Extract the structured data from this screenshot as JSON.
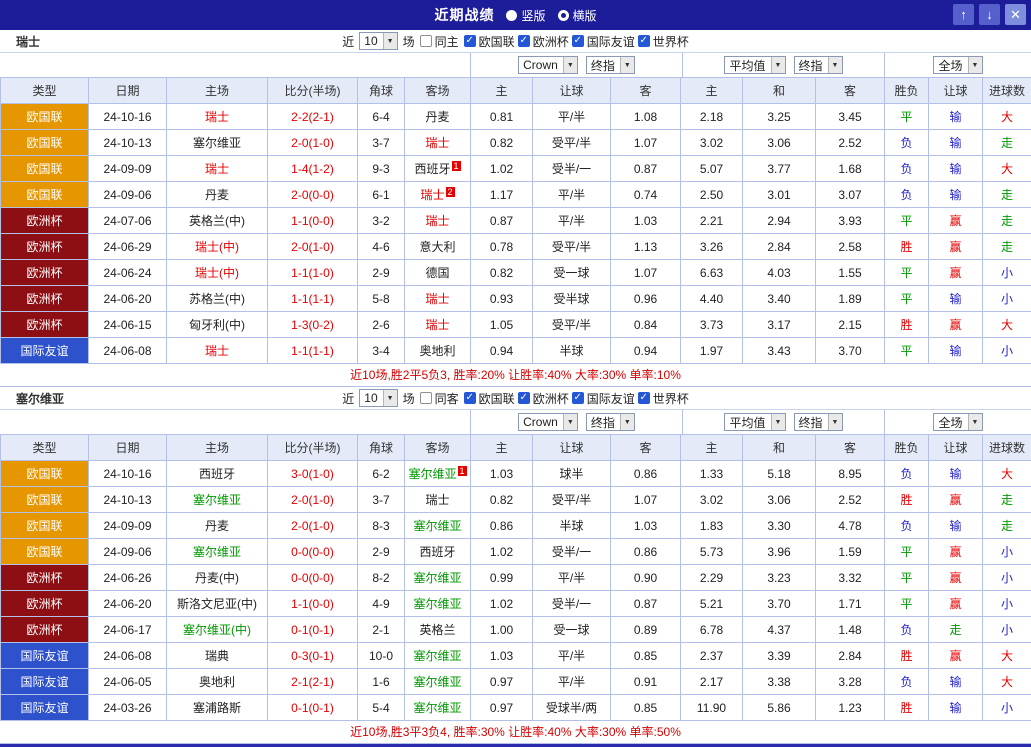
{
  "titlebar": {
    "title": "近期战绩",
    "vertical_label": "竖版",
    "horizontal_label": "横版",
    "vertical_selected": false,
    "horizontal_selected": true
  },
  "icons": {
    "up": "↑",
    "down": "↓",
    "close": "✕",
    "dropdown": "▼",
    "check": "✓"
  },
  "filters": {
    "recent_prefix": "近",
    "recent_count": "10",
    "recent_suffix": "场",
    "competitions": [
      "欧国联",
      "欧洲杯",
      "国际友谊",
      "世界杯"
    ],
    "handicap_source": "Crown",
    "handicap_stage": "终指",
    "euro_source": "平均值",
    "euro_stage": "终指",
    "scope": "全场"
  },
  "table_headers": [
    "类型",
    "日期",
    "主场",
    "比分(半场)",
    "角球",
    "客场",
    "主",
    "让球",
    "客",
    "主",
    "和",
    "客",
    "胜负",
    "让球",
    "进球数"
  ],
  "colors": {
    "titlebar_bg": "#1d1d9a",
    "grid": "#b3c0e8",
    "header_bg": "#e5eaf8",
    "type_map": {
      "欧国联": "#e59600",
      "欧洲杯": "#8e0f13",
      "国际友谊": "#2e52cc",
      "世界杯": "#2e52cc"
    },
    "team_map": {
      "red": "#e60000",
      "green": "#009900"
    },
    "result_map": {
      "胜": "#e60000",
      "赢": "#e60000",
      "大": "#e60000",
      "平": "#009900",
      "走": "#009900",
      "负": "#2222cc",
      "输": "#2222cc",
      "小": "#2222cc"
    },
    "score_red": "#e60000",
    "summary_red": "#d40000"
  },
  "sections": [
    {
      "team": "瑞士",
      "same_side_label": "同主",
      "rows": [
        [
          "欧国联",
          "24-10-16",
          [
            "瑞士",
            "red",
            ""
          ],
          "2-2(2-1)",
          "6-4",
          [
            "丹麦",
            "",
            ""
          ],
          "0.81",
          "平/半",
          "1.08",
          "2.18",
          "3.25",
          "3.45",
          "平",
          "输",
          "大"
        ],
        [
          "欧国联",
          "24-10-13",
          [
            "塞尔维亚",
            "",
            ""
          ],
          "2-0(1-0)",
          "3-7",
          [
            "瑞士",
            "red",
            ""
          ],
          "0.82",
          "受平/半",
          "1.07",
          "3.02",
          "3.06",
          "2.52",
          "负",
          "输",
          "走"
        ],
        [
          "欧国联",
          "24-09-09",
          [
            "瑞士",
            "red",
            ""
          ],
          "1-4(1-2)",
          "9-3",
          [
            "西班牙",
            "",
            "1"
          ],
          "1.02",
          "受半/一",
          "0.87",
          "5.07",
          "3.77",
          "1.68",
          "负",
          "输",
          "大"
        ],
        [
          "欧国联",
          "24-09-06",
          [
            "丹麦",
            "",
            ""
          ],
          "2-0(0-0)",
          "6-1",
          [
            "瑞士",
            "red",
            "2"
          ],
          "1.17",
          "平/半",
          "0.74",
          "2.50",
          "3.01",
          "3.07",
          "负",
          "输",
          "走"
        ],
        [
          "欧洲杯",
          "24-07-06",
          [
            "英格兰(中)",
            "",
            ""
          ],
          "1-1(0-0)",
          "3-2",
          [
            "瑞士",
            "red",
            ""
          ],
          "0.87",
          "平/半",
          "1.03",
          "2.21",
          "2.94",
          "3.93",
          "平",
          "赢",
          "走"
        ],
        [
          "欧洲杯",
          "24-06-29",
          [
            "瑞士(中)",
            "red",
            ""
          ],
          "2-0(1-0)",
          "4-6",
          [
            "意大利",
            "",
            ""
          ],
          "0.78",
          "受平/半",
          "1.13",
          "3.26",
          "2.84",
          "2.58",
          "胜",
          "赢",
          "走"
        ],
        [
          "欧洲杯",
          "24-06-24",
          [
            "瑞士(中)",
            "red",
            ""
          ],
          "1-1(1-0)",
          "2-9",
          [
            "德国",
            "",
            ""
          ],
          "0.82",
          "受一球",
          "1.07",
          "6.63",
          "4.03",
          "1.55",
          "平",
          "赢",
          "小"
        ],
        [
          "欧洲杯",
          "24-06-20",
          [
            "苏格兰(中)",
            "",
            ""
          ],
          "1-1(1-1)",
          "5-8",
          [
            "瑞士",
            "red",
            ""
          ],
          "0.93",
          "受半球",
          "0.96",
          "4.40",
          "3.40",
          "1.89",
          "平",
          "输",
          "小"
        ],
        [
          "欧洲杯",
          "24-06-15",
          [
            "匈牙利(中)",
            "",
            ""
          ],
          "1-3(0-2)",
          "2-6",
          [
            "瑞士",
            "red",
            ""
          ],
          "1.05",
          "受平/半",
          "0.84",
          "3.73",
          "3.17",
          "2.15",
          "胜",
          "赢",
          "大"
        ],
        [
          "国际友谊",
          "24-06-08",
          [
            "瑞士",
            "red",
            ""
          ],
          "1-1(1-1)",
          "3-4",
          [
            "奥地利",
            "",
            ""
          ],
          "0.94",
          "半球",
          "0.94",
          "1.97",
          "3.43",
          "3.70",
          "平",
          "输",
          "小"
        ]
      ],
      "summary": "近10场,胜2平5负3, 胜率:20% 让胜率:40% 大率:30% 单率:10%"
    },
    {
      "team": "塞尔维亚",
      "same_side_label": "同客",
      "rows": [
        [
          "欧国联",
          "24-10-16",
          [
            "西班牙",
            "",
            ""
          ],
          "3-0(1-0)",
          "6-2",
          [
            "塞尔维亚",
            "green",
            "1"
          ],
          "1.03",
          "球半",
          "0.86",
          "1.33",
          "5.18",
          "8.95",
          "负",
          "输",
          "大"
        ],
        [
          "欧国联",
          "24-10-13",
          [
            "塞尔维亚",
            "green",
            ""
          ],
          "2-0(1-0)",
          "3-7",
          [
            "瑞士",
            "",
            ""
          ],
          "0.82",
          "受平/半",
          "1.07",
          "3.02",
          "3.06",
          "2.52",
          "胜",
          "赢",
          "走"
        ],
        [
          "欧国联",
          "24-09-09",
          [
            "丹麦",
            "",
            ""
          ],
          "2-0(1-0)",
          "8-3",
          [
            "塞尔维亚",
            "green",
            ""
          ],
          "0.86",
          "半球",
          "1.03",
          "1.83",
          "3.30",
          "4.78",
          "负",
          "输",
          "走"
        ],
        [
          "欧国联",
          "24-09-06",
          [
            "塞尔维亚",
            "green",
            ""
          ],
          "0-0(0-0)",
          "2-9",
          [
            "西班牙",
            "",
            ""
          ],
          "1.02",
          "受半/一",
          "0.86",
          "5.73",
          "3.96",
          "1.59",
          "平",
          "赢",
          "小"
        ],
        [
          "欧洲杯",
          "24-06-26",
          [
            "丹麦(中)",
            "",
            ""
          ],
          "0-0(0-0)",
          "8-2",
          [
            "塞尔维亚",
            "green",
            ""
          ],
          "0.99",
          "平/半",
          "0.90",
          "2.29",
          "3.23",
          "3.32",
          "平",
          "赢",
          "小"
        ],
        [
          "欧洲杯",
          "24-06-20",
          [
            "斯洛文尼亚(中)",
            "",
            ""
          ],
          "1-1(0-0)",
          "4-9",
          [
            "塞尔维亚",
            "green",
            ""
          ],
          "1.02",
          "受半/一",
          "0.87",
          "5.21",
          "3.70",
          "1.71",
          "平",
          "赢",
          "小"
        ],
        [
          "欧洲杯",
          "24-06-17",
          [
            "塞尔维亚(中)",
            "green",
            ""
          ],
          "0-1(0-1)",
          "2-1",
          [
            "英格兰",
            "",
            ""
          ],
          "1.00",
          "受一球",
          "0.89",
          "6.78",
          "4.37",
          "1.48",
          "负",
          "走",
          "小"
        ],
        [
          "国际友谊",
          "24-06-08",
          [
            "瑞典",
            "",
            ""
          ],
          "0-3(0-1)",
          "10-0",
          [
            "塞尔维亚",
            "green",
            ""
          ],
          "1.03",
          "平/半",
          "0.85",
          "2.37",
          "3.39",
          "2.84",
          "胜",
          "赢",
          "大"
        ],
        [
          "国际友谊",
          "24-06-05",
          [
            "奥地利",
            "",
            ""
          ],
          "2-1(2-1)",
          "1-6",
          [
            "塞尔维亚",
            "green",
            ""
          ],
          "0.97",
          "平/半",
          "0.91",
          "2.17",
          "3.38",
          "3.28",
          "负",
          "输",
          "大"
        ],
        [
          "国际友谊",
          "24-03-26",
          [
            "塞浦路斯",
            "",
            ""
          ],
          "0-1(0-1)",
          "5-4",
          [
            "塞尔维亚",
            "green",
            ""
          ],
          "0.97",
          "受球半/两",
          "0.85",
          "11.90",
          "5.86",
          "1.23",
          "胜",
          "输",
          "小"
        ]
      ],
      "summary": "近10场,胜3平3负4, 胜率:30% 让胜率:40% 大率:30% 单率:50%"
    }
  ]
}
